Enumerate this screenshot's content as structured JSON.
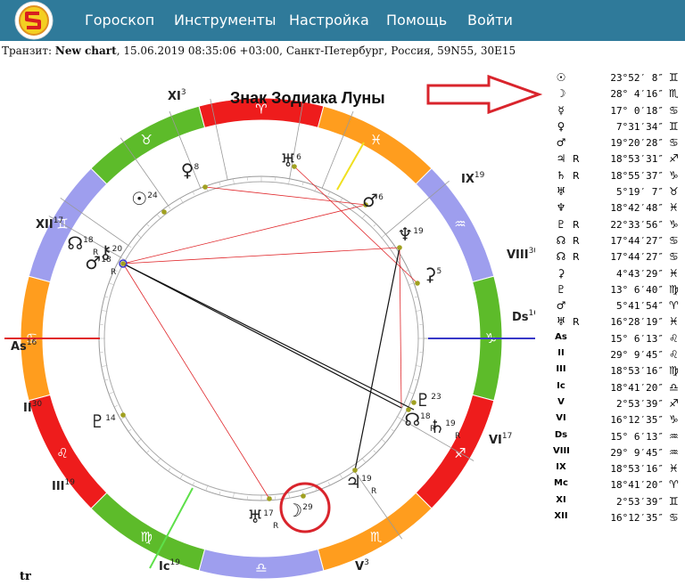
{
  "nav": {
    "items": [
      "Гороскоп",
      "Инструменты",
      "Настройка",
      "Помощь",
      "Войти"
    ]
  },
  "transit": {
    "prefix": "Транзит:",
    "chart_name": "New chart",
    "details": ", 15.06.2019 08:35:06 +03:00, Санкт-Петербург, Россия, 59N55, 30E15"
  },
  "annotation": {
    "text": "Знак Зодиака Луны"
  },
  "colors": {
    "fire": "#ee1c1c",
    "earth": "#5dbb2a",
    "air": "#9e9eee",
    "water": "#ff9d1e",
    "nav_bg": "#2f7a9a",
    "annotation": "#d9242c",
    "aspect_red": "#e0262a",
    "aspect_black": "#111111"
  },
  "zodiac": [
    {
      "sign": "♋",
      "element": "water",
      "label": "♋"
    },
    {
      "sign": "♊",
      "element": "air",
      "label": "♊"
    },
    {
      "sign": "♉",
      "element": "earth",
      "label": "♉"
    },
    {
      "sign": "♈",
      "element": "fire",
      "label": "♈"
    },
    {
      "sign": "♓",
      "element": "water",
      "label": "♓"
    },
    {
      "sign": "♒",
      "element": "air",
      "label": "♒"
    },
    {
      "sign": "♑",
      "element": "earth",
      "label": "♑"
    },
    {
      "sign": "♐",
      "element": "fire",
      "label": "♐"
    },
    {
      "sign": "♏",
      "element": "water",
      "label": "♏"
    },
    {
      "sign": "♎",
      "element": "air",
      "label": "♎"
    },
    {
      "sign": "♍",
      "element": "earth",
      "label": "♍"
    },
    {
      "sign": "♌",
      "element": "fire",
      "label": "♌"
    }
  ],
  "houses": [
    {
      "name": "As",
      "deg": "16"
    },
    {
      "name": "II",
      "deg": "30"
    },
    {
      "name": "III",
      "deg": "19"
    },
    {
      "name": "Ic",
      "deg": "19"
    },
    {
      "name": "V",
      "deg": "3"
    },
    {
      "name": "VI",
      "deg": "17"
    },
    {
      "name": "Ds",
      "deg": "16"
    },
    {
      "name": "VIII",
      "deg": "30"
    },
    {
      "name": "IX",
      "deg": "19"
    },
    {
      "name": "XI",
      "deg": "3"
    },
    {
      "name": "XII",
      "deg": "17"
    }
  ],
  "chart_planets": [
    {
      "glyph": "☉",
      "deg": "24"
    },
    {
      "glyph": "♀",
      "deg": "8"
    },
    {
      "glyph": "♅",
      "deg": "6"
    },
    {
      "glyph": "♂",
      "deg": "6"
    },
    {
      "glyph": "♆",
      "deg": "19"
    },
    {
      "glyph": "⚳",
      "deg": "5"
    },
    {
      "glyph": "☊",
      "deg": "18",
      "retro": "R"
    },
    {
      "glyph": "♂",
      "deg": "18",
      "retro": "R"
    },
    {
      "glyph": "⚷",
      "deg": "20"
    },
    {
      "glyph": "♇",
      "deg": "14"
    },
    {
      "glyph": "♇",
      "deg": "23"
    },
    {
      "glyph": "☊",
      "deg": "18",
      "retro": "R"
    },
    {
      "glyph": "♄",
      "deg": "19",
      "retro": "R"
    },
    {
      "glyph": "♃",
      "deg": "19",
      "retro": "R"
    },
    {
      "glyph": "☽",
      "deg": "29"
    },
    {
      "glyph": "♅",
      "deg": "17",
      "retro": "R"
    }
  ],
  "table": [
    {
      "glyph": "☉",
      "r": "",
      "value": "23°52′ 8″",
      "sign": "♊"
    },
    {
      "glyph": "☽",
      "r": "",
      "value": "28° 4′16″",
      "sign": "♏"
    },
    {
      "glyph": "☿",
      "r": "",
      "value": "17° 0′18″",
      "sign": "♋"
    },
    {
      "glyph": "♀",
      "r": "",
      "value": "7°31′34″",
      "sign": "♊"
    },
    {
      "glyph": "♂",
      "r": "",
      "value": "19°20′28″",
      "sign": "♋"
    },
    {
      "glyph": "♃",
      "r": "R",
      "value": "18°53′31″",
      "sign": "♐"
    },
    {
      "glyph": "♄",
      "r": "R",
      "value": "18°55′37″",
      "sign": "♑"
    },
    {
      "glyph": "♅",
      "r": "",
      "value": "5°19′ 7″",
      "sign": "♉"
    },
    {
      "glyph": "♆",
      "r": "",
      "value": "18°42′48″",
      "sign": "♓"
    },
    {
      "glyph": "♇",
      "r": "R",
      "value": "22°33′56″",
      "sign": "♑"
    },
    {
      "glyph": "☊",
      "r": "R",
      "value": "17°44′27″",
      "sign": "♋"
    },
    {
      "glyph": "☊",
      "r": "R",
      "value": "17°44′27″",
      "sign": "♋"
    },
    {
      "glyph": "⚳",
      "r": "",
      "value": "4°43′29″",
      "sign": "♓"
    },
    {
      "glyph": "♇",
      "r": "",
      "value": "13° 6′40″",
      "sign": "♍"
    },
    {
      "glyph": "♂",
      "r": "",
      "value": "5°41′54″",
      "sign": "♈"
    },
    {
      "glyph": "♅",
      "r": "R",
      "value": "16°28′19″",
      "sign": "♓"
    },
    {
      "glyph": "As",
      "r": "",
      "value": "15° 6′13″",
      "sign": "♌"
    },
    {
      "glyph": "II",
      "r": "",
      "value": "29° 9′45″",
      "sign": "♌"
    },
    {
      "glyph": "III",
      "r": "",
      "value": "18°53′16″",
      "sign": "♍"
    },
    {
      "glyph": "Ic",
      "r": "",
      "value": "18°41′20″",
      "sign": "♎"
    },
    {
      "glyph": "V",
      "r": "",
      "value": "2°53′39″",
      "sign": "♐"
    },
    {
      "glyph": "VI",
      "r": "",
      "value": "16°12′35″",
      "sign": "♑"
    },
    {
      "glyph": "Ds",
      "r": "",
      "value": "15° 6′13″",
      "sign": "♒"
    },
    {
      "glyph": "VIII",
      "r": "",
      "value": "29° 9′45″",
      "sign": "♒"
    },
    {
      "glyph": "IX",
      "r": "",
      "value": "18°53′16″",
      "sign": "♓"
    },
    {
      "glyph": "Mc",
      "r": "",
      "value": "18°41′20″",
      "sign": "♈"
    },
    {
      "glyph": "XI",
      "r": "",
      "value": "2°53′39″",
      "sign": "♊"
    },
    {
      "glyph": "XII",
      "r": "",
      "value": "16°12′35″",
      "sign": "♋"
    }
  ],
  "footer": {
    "tr": "tr"
  }
}
